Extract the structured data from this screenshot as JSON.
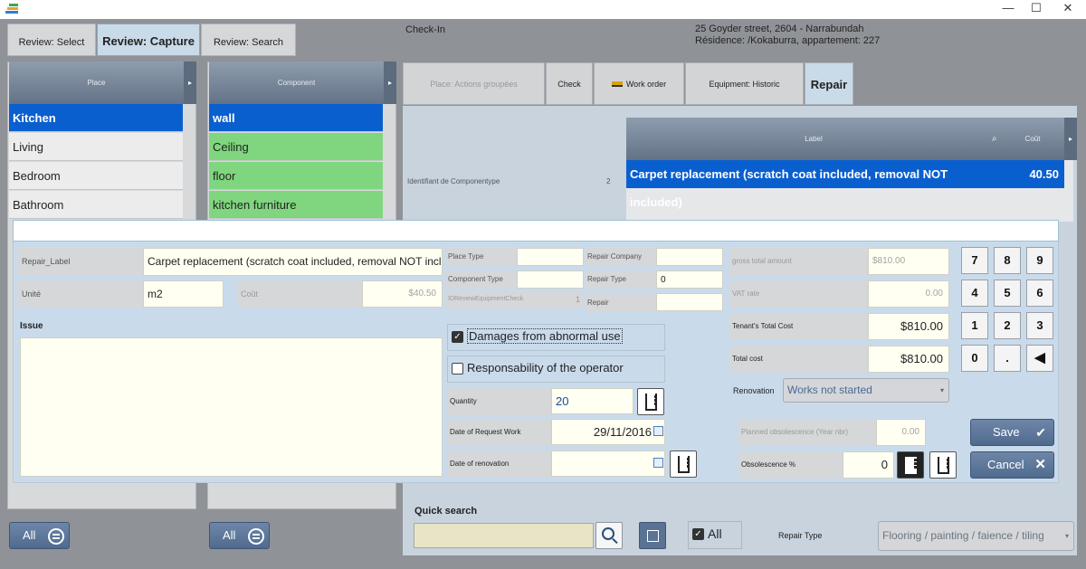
{
  "window": {
    "minimize": "—",
    "maximize": "☐",
    "close": "✕"
  },
  "top_tabs": [
    "Review: Select",
    "Review: Capture",
    "Review: Search"
  ],
  "checkin": {
    "label": "Check-In",
    "address_line1": "25 Goyder street, 2604 - Narrabundah",
    "address_line2": "Résidence: /Kokaburra, appartement: 227"
  },
  "place_panel": {
    "header": "Place",
    "items": [
      "Kitchen",
      "Living",
      "Bedroom",
      "Bathroom"
    ],
    "all_label": "All"
  },
  "component_panel": {
    "header": "Component",
    "items": [
      "wall",
      "Ceiling",
      "floor",
      "kitchen furniture"
    ],
    "all_label": "All"
  },
  "right_tabs": [
    "Place: Actions groupées",
    "Check",
    "Work order",
    "Equipment: Historic",
    "Repair"
  ],
  "repair_grid": {
    "id_label": "Identifiant de Componentype",
    "id_value": "2",
    "col_label": "Label",
    "col_cost": "Coût",
    "row_label": "Carpet replacement (scratch coat included, removal NOT included)",
    "row_cost": "40.50"
  },
  "form": {
    "repair_label_lbl": "Repair_Label",
    "repair_label_val": "Carpet replacement (scratch coat included, removal NOT included)",
    "unite_lbl": "Unité",
    "unite_val": "m2",
    "cout_lbl": "Coût",
    "cout_val": "$40.50",
    "issue_lbl": "Issue",
    "place_type_lbl": "Place Type",
    "component_type_lbl": "Component Type",
    "idreview_lbl": "IDReviewEquipmentCheck",
    "idreview_val": "1",
    "repair_company_lbl": "Repair Company",
    "repair_type_lbl": "Repair Type",
    "repair_type_val": "0",
    "repair_lbl": "Repair",
    "damages_lbl": "Damages from abnormal use",
    "responsability_lbl": "Responsability of the operator",
    "quantity_lbl": "Quantity",
    "quantity_val": "20",
    "date_request_lbl": "Date of Request Work",
    "date_request_val": "29/11/2016",
    "date_renovation_lbl": "Date of renovation",
    "gross_lbl": "gross total amount",
    "gross_val": "$810.00",
    "vat_lbl": "VAT rate",
    "vat_val": "0.00",
    "tenant_lbl": "Tenant's Total Cost",
    "tenant_val": "$810.00",
    "total_lbl": "Total cost",
    "total_val": "$810.00",
    "renovation_lbl": "Renovation",
    "renovation_val": "Works not started",
    "planned_lbl": "Planned obsolescence (Year nbr)",
    "planned_val": "0.00",
    "obsolescence_lbl": "Obsolescence %",
    "obsolescence_val": "0",
    "keys": [
      "7",
      "8",
      "9",
      "4",
      "5",
      "6",
      "1",
      "2",
      "3",
      "0",
      "."
    ],
    "save": "Save",
    "cancel": "Cancel"
  },
  "bottom": {
    "quick_search": "Quick search",
    "all_label": "All",
    "repair_type_lbl": "Repair Type",
    "repair_type_val": "Flooring / painting / faience / tiling"
  }
}
